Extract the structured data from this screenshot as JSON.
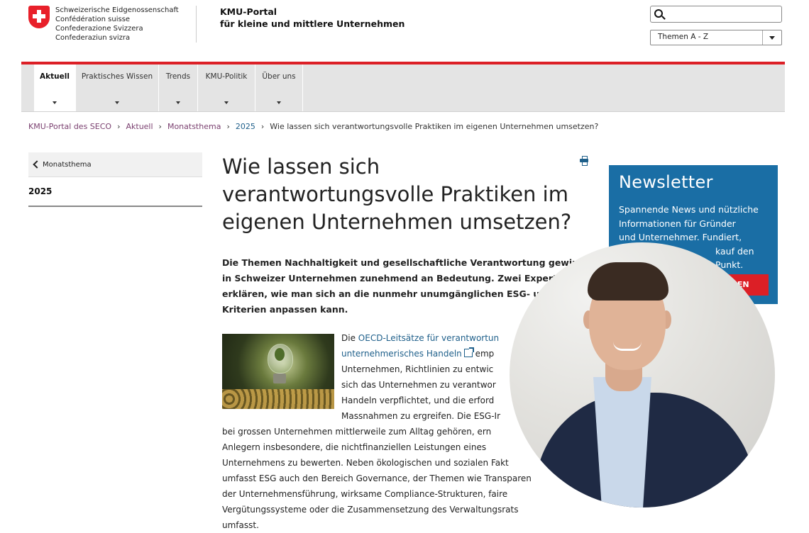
{
  "header": {
    "confederation": [
      "Schweizerische Eidgenossenschaft",
      "Confédération suisse",
      "Confederazione Svizzera",
      "Confederaziun svizra"
    ],
    "portal_title_line1": "KMU-Portal",
    "portal_title_line2": "für kleine und mittlere Unternehmen",
    "search_placeholder": "",
    "topics_select": "Themen A - Z"
  },
  "nav": {
    "tabs": [
      {
        "label": "Aktuell",
        "active": true
      },
      {
        "label": "Praktisches Wissen",
        "active": false
      },
      {
        "label": "Trends",
        "active": false
      },
      {
        "label": "KMU-Politik",
        "active": false
      },
      {
        "label": "Über uns",
        "active": false
      }
    ]
  },
  "breadcrumb": [
    "KMU-Portal des SECO",
    "Aktuell",
    "Monatsthema",
    "2025",
    "Wie lassen sich verantwortungsvolle Praktiken im eigenen Unternehmen umsetzen?"
  ],
  "sidebar": {
    "back_label": "Monatsthema",
    "current": "2025"
  },
  "article": {
    "title": "Wie lassen sich verantwortungsvolle Praktiken im eigenen Unternehmen umsetzen?",
    "lead": "Die Themen Nachhaltigkeit und gesellschaftliche Verantwortung gewinn in Schweizer Unternehmen zunehmend an Bedeutung. Zwei Experte erklären, wie man sich an die nunmehr unumgänglichen ESG- un Kriterien anpassen kann.",
    "p_intro": "Die",
    "p_link_1": "OECD-Leitsätze für verantwortun",
    "p_link_2": "unternehmerisches Handeln",
    "p_line1_tail": "emp",
    "p_line3": "Unternehmen, Richtlinien zu entwic",
    "p_line4": "sich das Unternehmen zu verantwor",
    "p_line5": "Handeln verpflichtet, und die erford",
    "p_line6": "Massnahmen zu ergreifen. Die ESG-Ir",
    "p_line7": "bei grossen Unternehmen mittlerweile zum Alltag gehören, ern",
    "p_line8": "Anlegern insbesondere, die nichtfinanziellen Leistungen eines",
    "p_line9": "Unternehmens zu bewerten. Neben ökologischen und sozialen Fakt",
    "p_line10": "umfasst ESG auch den Bereich Governance, der Themen wie Transparen",
    "p_line11": "der Unternehmensführung, wirksame Compliance-Strukturen, faire",
    "p_line12": "Vergütungssysteme oder die Zusammensetzung des Verwaltungsrats",
    "p_line13": "umfasst."
  },
  "newsletter": {
    "title": "Newsletter",
    "text_line1": "Spannende News und nützliche",
    "text_line2": "Informationen für Gründer",
    "text_line3": "und Unternehmer. Fundiert,",
    "text_line4": "kauf den Punkt.",
    "button": "REN"
  },
  "colors": {
    "swiss_red": "#dc1f26",
    "newsletter_blue": "#1a6ea5",
    "link_blue": "#1e5f8a",
    "breadcrumb_purple": "#7a3f6f"
  }
}
